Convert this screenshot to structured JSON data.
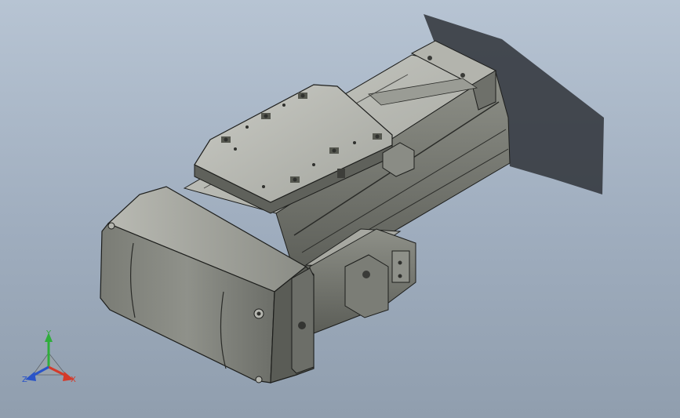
{
  "triad": {
    "x_label": "X",
    "y_label": "Y",
    "z_label": "Z",
    "colors": {
      "x": "#d43a2a",
      "y": "#2fae3b",
      "z": "#2a54c8"
    }
  },
  "palette": {
    "background_top": "#b7c4d3",
    "background_bottom": "#909eae",
    "steel_light": "#c8c9c3",
    "steel_mid": "#8c8e86",
    "steel_dark": "#4e504b",
    "edge": "#1d1e1c",
    "shadow": "#3b3f45"
  }
}
